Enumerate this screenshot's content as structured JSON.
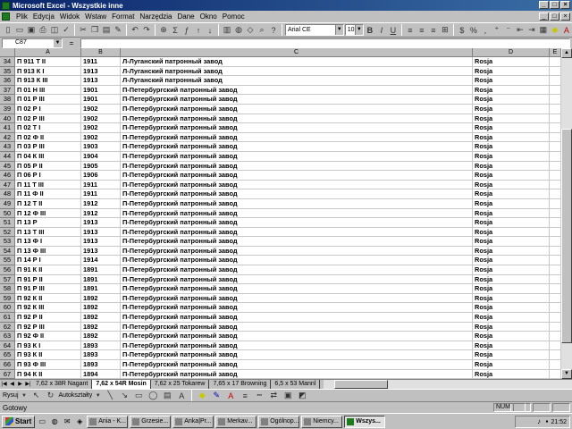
{
  "window": {
    "title": "Microsoft Excel - Wszystkie inne"
  },
  "menu": {
    "items": [
      "Plik",
      "Edycja",
      "Widok",
      "Wstaw",
      "Format",
      "Narzędzia",
      "Dane",
      "Okno",
      "Pomoc"
    ]
  },
  "toolbar": {
    "font_name": "Arial CE",
    "font_size": "10"
  },
  "formula_bar": {
    "cell_ref": "C87",
    "equals": "="
  },
  "grid": {
    "columns": [
      "A",
      "B",
      "C",
      "D",
      "E"
    ],
    "rows": [
      {
        "n": "34",
        "a": "П 911 Т II",
        "b": "1911",
        "c": "Л-Луганский патронный завод",
        "d": "Rosja"
      },
      {
        "n": "35",
        "a": "П 913 К I",
        "b": "1913",
        "c": "Л-Луганский патронный завод",
        "d": "Rosja"
      },
      {
        "n": "36",
        "a": "П 913 К III",
        "b": "1913",
        "c": "Л-Луганский патронный завод",
        "d": "Rosja"
      },
      {
        "n": "37",
        "a": "П 01 Н III",
        "b": "1901",
        "c": "П-Петербургский патронный завод",
        "d": "Rosja"
      },
      {
        "n": "38",
        "a": "П 01 Р III",
        "b": "1901",
        "c": "П-Петербургский патронный завод",
        "d": "Rosja"
      },
      {
        "n": "39",
        "a": "П 02 Р I",
        "b": "1902",
        "c": "П-Петербургский патронный завод",
        "d": "Rosja"
      },
      {
        "n": "40",
        "a": "П 02 Р III",
        "b": "1902",
        "c": "П-Петербургский патронный завод",
        "d": "Rosja"
      },
      {
        "n": "41",
        "a": "П 02 Т I",
        "b": "1902",
        "c": "П-Петербургский патронный завод",
        "d": "Rosja"
      },
      {
        "n": "42",
        "a": "П 02 Ф II",
        "b": "1902",
        "c": "П-Петербургский патронный завод",
        "d": "Rosja"
      },
      {
        "n": "43",
        "a": "П 03 Р III",
        "b": "1903",
        "c": "П-Петербургский патронный завод",
        "d": "Rosja"
      },
      {
        "n": "44",
        "a": "П 04 К III",
        "b": "1904",
        "c": "П-Петербургский патронный завод",
        "d": "Rosja"
      },
      {
        "n": "45",
        "a": "П 05 Р II",
        "b": "1905",
        "c": "П-Петербургский патронный завод",
        "d": "Rosja"
      },
      {
        "n": "46",
        "a": "П 06 Р I",
        "b": "1906",
        "c": "П-Петербургский патронный завод",
        "d": "Rosja"
      },
      {
        "n": "47",
        "a": "П 11 Т III",
        "b": "1911",
        "c": "П-Петербургский патронный завод",
        "d": "Rosja"
      },
      {
        "n": "48",
        "a": "П 11 Ф II",
        "b": "1911",
        "c": "П-Петербургский патронный завод",
        "d": "Rosja"
      },
      {
        "n": "49",
        "a": "П 12 Т II",
        "b": "1912",
        "c": "П-Петербургский патронный завод",
        "d": "Rosja"
      },
      {
        "n": "50",
        "a": "П 12 Ф III",
        "b": "1912",
        "c": "П-Петербургский патронный завод",
        "d": "Rosja"
      },
      {
        "n": "51",
        "a": "П 13 Р",
        "b": "1913",
        "c": "П-Петербургский патронный завод",
        "d": "Rosja"
      },
      {
        "n": "52",
        "a": "П 13 Т III",
        "b": "1913",
        "c": "П-Петербургский патронный завод",
        "d": "Rosja"
      },
      {
        "n": "53",
        "a": "П 13 Ф I",
        "b": "1913",
        "c": "П-Петербургский патронный завод",
        "d": "Rosja"
      },
      {
        "n": "54",
        "a": "П 13 Ф III",
        "b": "1913",
        "c": "П-Петербургский патронный завод",
        "d": "Rosja"
      },
      {
        "n": "55",
        "a": "П 14 Р I",
        "b": "1914",
        "c": "П-Петербургский патронный завод",
        "d": "Rosja"
      },
      {
        "n": "56",
        "a": "П 91 К II",
        "b": "1891",
        "c": "П-Петербургский патронный завод",
        "d": "Rosja"
      },
      {
        "n": "57",
        "a": "П 91 Р II",
        "b": "1891",
        "c": "П-Петербургский патронный завод",
        "d": "Rosja"
      },
      {
        "n": "58",
        "a": "П 91 Р III",
        "b": "1891",
        "c": "П-Петербургский патронный завод",
        "d": "Rosja"
      },
      {
        "n": "59",
        "a": "П 92 К II",
        "b": "1892",
        "c": "П-Петербургский патронный завод",
        "d": "Rosja"
      },
      {
        "n": "60",
        "a": "П 92 К III",
        "b": "1892",
        "c": "П-Петербургский патронный завод",
        "d": "Rosja"
      },
      {
        "n": "61",
        "a": "П 92 Р II",
        "b": "1892",
        "c": "П-Петербургский патронный завод",
        "d": "Rosja"
      },
      {
        "n": "62",
        "a": "П 92 Р III",
        "b": "1892",
        "c": "П-Петербургский патронный завод",
        "d": "Rosja"
      },
      {
        "n": "63",
        "a": "П 92 Ф II",
        "b": "1892",
        "c": "П-Петербургский патронный завод",
        "d": "Rosja"
      },
      {
        "n": "64",
        "a": "П 93 К I",
        "b": "1893",
        "c": "П-Петербургский патронный завод",
        "d": "Rosja"
      },
      {
        "n": "65",
        "a": "П 93 К II",
        "b": "1893",
        "c": "П-Петербургский патронный завод",
        "d": "Rosja"
      },
      {
        "n": "66",
        "a": "П 93 Ф III",
        "b": "1893",
        "c": "П-Петербургский патронный завод",
        "d": "Rosja"
      },
      {
        "n": "67",
        "a": "П 94 К II",
        "b": "1894",
        "c": "П-Петербургский патронный завод",
        "d": "Rosja"
      }
    ]
  },
  "sheets": {
    "tabs": [
      "7,62 x 38R Nagant",
      "7,62 x 54R Mosin",
      "7,62 x 25 Tokarew",
      "7,65 x 17 Browning",
      "6,5 x 53 Mannl"
    ],
    "active_index": 1
  },
  "drawing_toolbar": {
    "draw_label": "Rysuj",
    "autoshapes_label": "Autokształty"
  },
  "status": {
    "text": "Gotowy",
    "num": "NUM"
  },
  "taskbar": {
    "start_label": "Start",
    "tasks": [
      "Ania - K...",
      "Grzesie...",
      "Anka|Pr...",
      "Merkav...",
      "Ogólnop...",
      "Niemcy...",
      "Wszys..."
    ],
    "active_index": 6,
    "clock": "21:52"
  }
}
